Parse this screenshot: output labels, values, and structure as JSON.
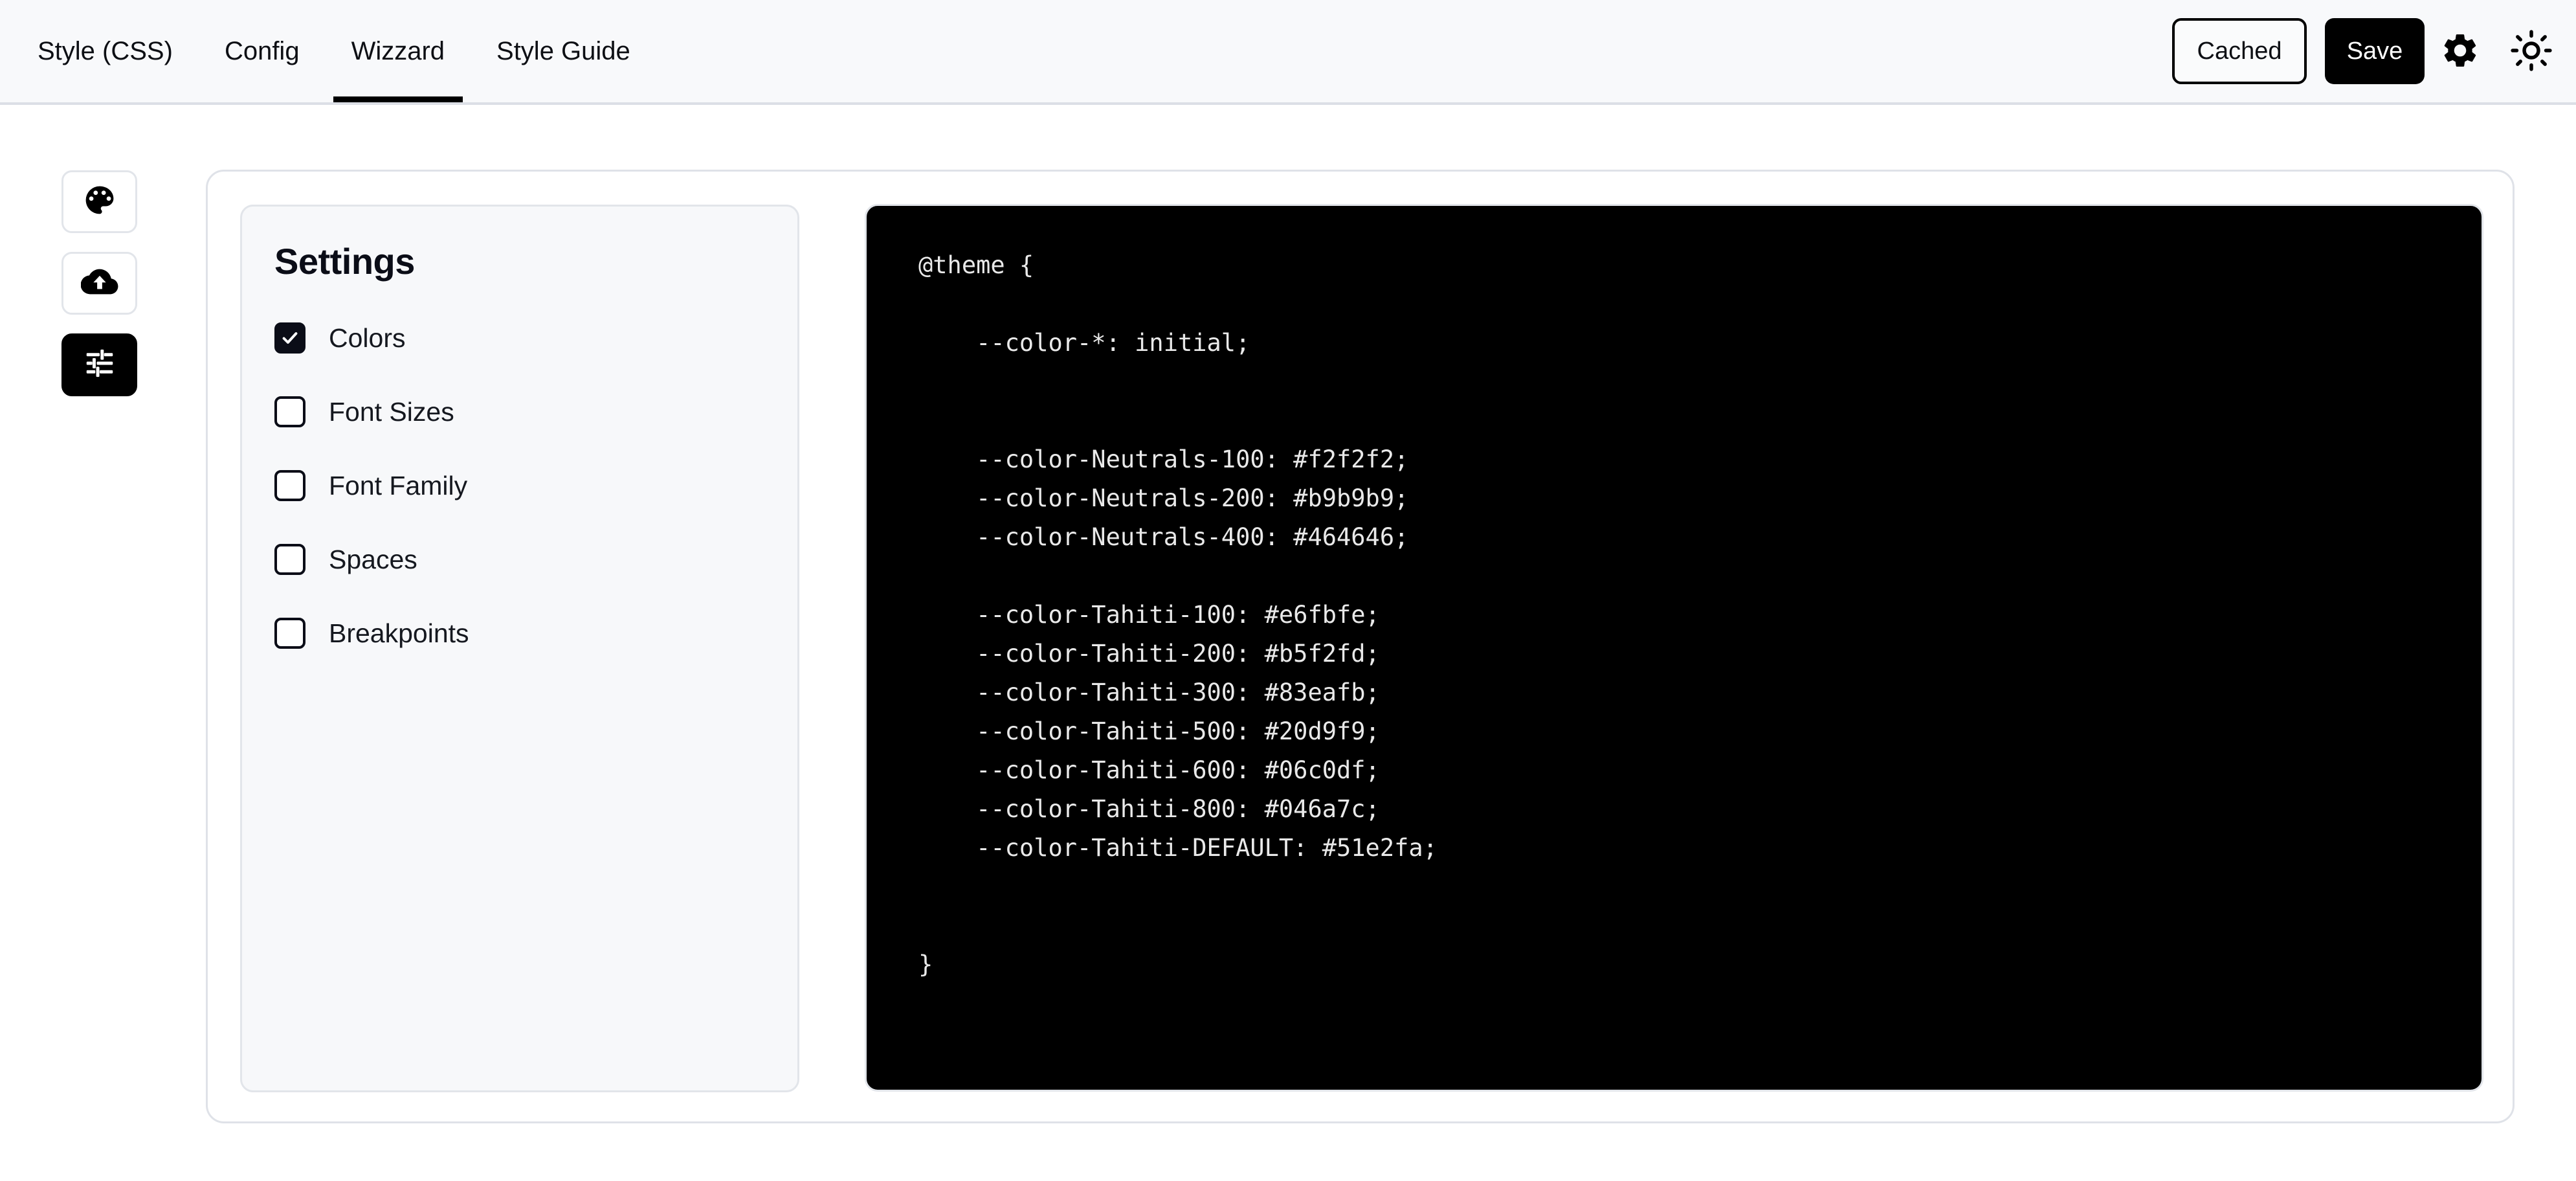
{
  "header": {
    "tabs": [
      {
        "label": "Style (CSS)",
        "active": false
      },
      {
        "label": "Config",
        "active": false
      },
      {
        "label": "Wizzard",
        "active": true
      },
      {
        "label": "Style Guide",
        "active": false
      }
    ],
    "cached_label": "Cached",
    "save_label": "Save",
    "settings_icon": "gear-icon",
    "theme_icon": "sun-icon"
  },
  "rail": {
    "items": [
      {
        "icon": "palette-icon",
        "active": false
      },
      {
        "icon": "cloud-upload-icon",
        "active": false
      },
      {
        "icon": "tune-sliders-icon",
        "active": true
      }
    ]
  },
  "settings": {
    "title": "Settings",
    "options": [
      {
        "label": "Colors",
        "checked": true
      },
      {
        "label": "Font Sizes",
        "checked": false
      },
      {
        "label": "Font Family",
        "checked": false
      },
      {
        "label": "Spaces",
        "checked": false
      },
      {
        "label": "Breakpoints",
        "checked": false
      }
    ]
  },
  "code": {
    "language": "css",
    "text": "@theme {\n\n    --color-*: initial;\n\n\n    --color-Neutrals-100: #f2f2f2;\n    --color-Neutrals-200: #b9b9b9;\n    --color-Neutrals-400: #464646;\n\n    --color-Tahiti-100: #e6fbfe;\n    --color-Tahiti-200: #b5f2fd;\n    --color-Tahiti-300: #83eafb;\n    --color-Tahiti-500: #20d9f9;\n    --color-Tahiti-600: #06c0df;\n    --color-Tahiti-800: #046a7c;\n    --color-Tahiti-DEFAULT: #51e2fa;\n\n\n}",
    "tokens": {
      "at_rule": "@theme",
      "variables": [
        {
          "name": "--color-*",
          "value": "initial"
        },
        {
          "name": "--color-Neutrals-100",
          "value": "#f2f2f2"
        },
        {
          "name": "--color-Neutrals-200",
          "value": "#b9b9b9"
        },
        {
          "name": "--color-Neutrals-400",
          "value": "#464646"
        },
        {
          "name": "--color-Tahiti-100",
          "value": "#e6fbfe"
        },
        {
          "name": "--color-Tahiti-200",
          "value": "#b5f2fd"
        },
        {
          "name": "--color-Tahiti-300",
          "value": "#83eafb"
        },
        {
          "name": "--color-Tahiti-500",
          "value": "#20d9f9"
        },
        {
          "name": "--color-Tahiti-600",
          "value": "#06c0df"
        },
        {
          "name": "--color-Tahiti-800",
          "value": "#046a7c"
        },
        {
          "name": "--color-Tahiti-DEFAULT",
          "value": "#51e2fa"
        }
      ]
    }
  },
  "colors": {
    "page_bg": "#ffffff",
    "header_bg": "#f8f9fb",
    "accent_black": "#000000",
    "panel_bg": "#f7f8fa",
    "border": "#e2e5ea",
    "code_bg": "#000000",
    "code_text": "#e9e9e9",
    "checkbox_checked": "#0b0d17"
  }
}
